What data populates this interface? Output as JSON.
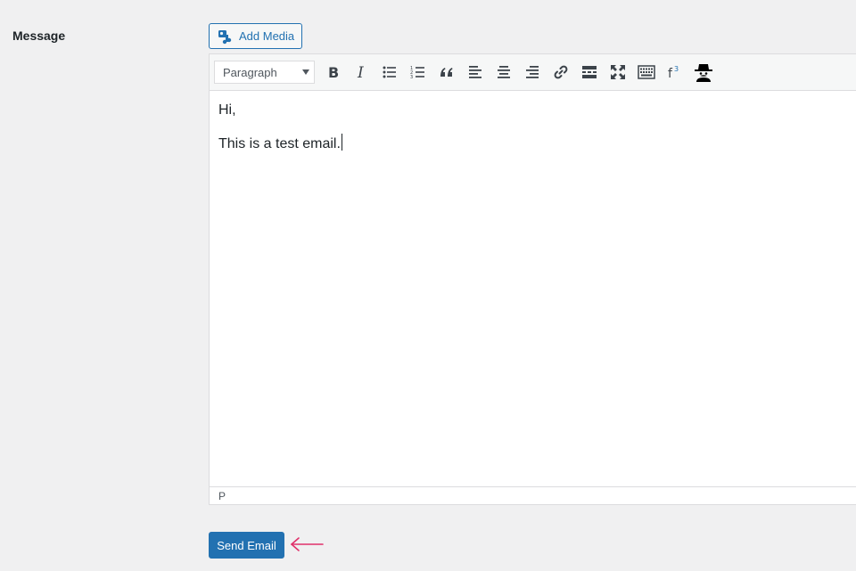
{
  "form": {
    "message_label": "Message"
  },
  "media": {
    "add_media_label": "Add Media"
  },
  "toolbar": {
    "format_value": "Paragraph",
    "buttons": [
      {
        "name": "bold-icon",
        "glyph": "B"
      },
      {
        "name": "italic-icon",
        "glyph": "I"
      },
      {
        "name": "bulleted-list-icon"
      },
      {
        "name": "numbered-list-icon"
      },
      {
        "name": "blockquote-icon"
      },
      {
        "name": "align-left-icon"
      },
      {
        "name": "align-center-icon"
      },
      {
        "name": "align-right-icon"
      },
      {
        "name": "link-icon"
      },
      {
        "name": "read-more-icon"
      },
      {
        "name": "fullscreen-icon"
      },
      {
        "name": "toolbar-toggle-icon"
      },
      {
        "name": "footnote-icon",
        "glyph": "f",
        "sup": "3"
      },
      {
        "name": "incognito-icon"
      }
    ]
  },
  "editor": {
    "paragraphs": [
      "Hi,",
      "This is a test email."
    ],
    "status_path": "P"
  },
  "actions": {
    "send_label": "Send Email"
  },
  "colors": {
    "accent": "#2271b1",
    "annotation_arrow": "#e0306a",
    "background": "#f0f0f1"
  }
}
